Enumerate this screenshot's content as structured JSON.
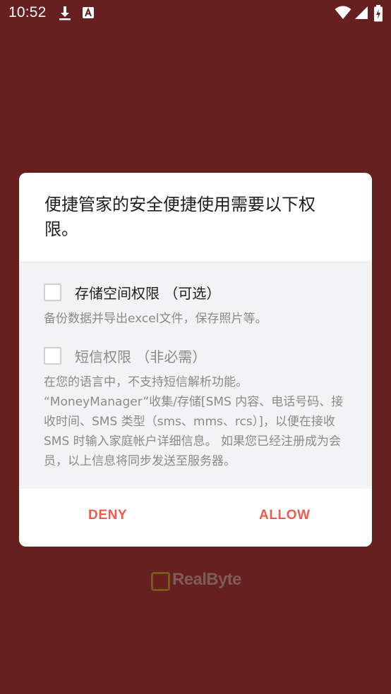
{
  "status_bar": {
    "time": "10:52",
    "icons": [
      "download-icon",
      "a-icon",
      "wifi-icon",
      "signal-icon",
      "battery-icon"
    ]
  },
  "dialog": {
    "title": "便捷管家的安全便捷使用需要以下权限。",
    "permissions": [
      {
        "label": "存储空间权限 （可选）",
        "checked": false,
        "description": "备份数据并导出excel文件，保存照片等。"
      },
      {
        "label": "短信权限 （非必需）",
        "checked": false,
        "description_line1": "在您的语言中，不支持短信解析功能。",
        "description_line2": "“MoneyManager”收集/存储[SMS 内容、电话号码、接收时间、SMS 类型（sms、mms、rcs）]，以便在接收SMS 时输入家庭帐户详细信息。 如果您已经注册成为会员，以上信息将同步发送至服务器。"
      }
    ],
    "deny_label": "DENY",
    "allow_label": "ALLOW"
  },
  "logo": {
    "text": "RealByte"
  },
  "colors": {
    "background": "#65201f",
    "accent": "#f05a4f",
    "body_background": "#f3f3f5"
  }
}
